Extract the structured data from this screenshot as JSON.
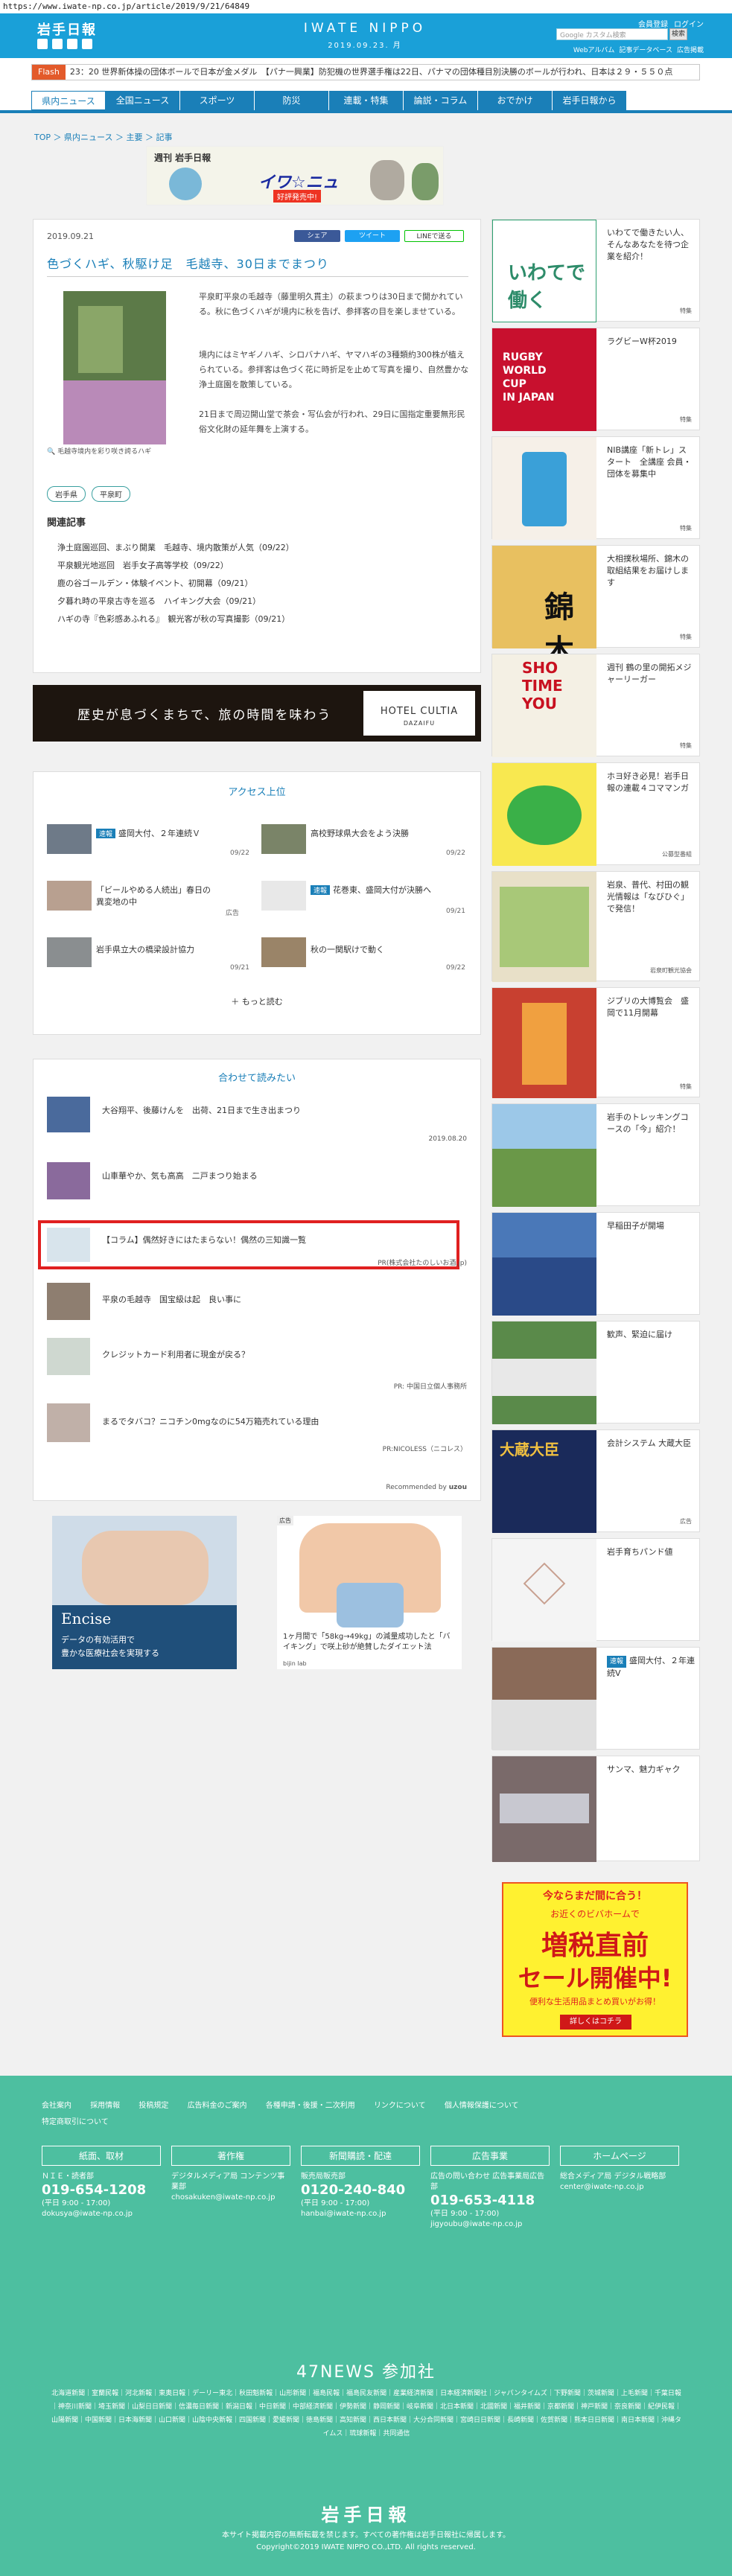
{
  "browser": {
    "url": "https://www.iwate-np.co.jp/article/2019/9/21/64849"
  },
  "header": {
    "logo": "岩手日報",
    "brand": "IWATE NIPPO",
    "date": "2019.09.23. 月",
    "links": [
      "会員登録",
      "ログイン"
    ],
    "search_placeholder": "Google カスタム検索",
    "search_button": "検索",
    "sub_links": [
      "Webアルバム",
      "記事データベース",
      "広告掲載"
    ]
  },
  "ticker": {
    "tag": "Flash",
    "time": "23：20",
    "text": "世界新体操の団体ボールで日本が金メダル　【パナ一興業】防犯機の世界選手権は22日、パナマの団体種目別決勝のボールが行われ、日本は２９・５５０点"
  },
  "nav": [
    "県内ニュース",
    "全国ニュース",
    "スポーツ",
    "防災",
    "連載・特集",
    "論説・コラム",
    "おでかけ",
    "岩手日報から"
  ],
  "breadcrumb": "TOP ＞ 県内ニュース ＞ 主要 ＞ 記事",
  "banner": {
    "title": "週刊 岩手日報",
    "title2": "イワ☆ニュ",
    "badge": "好評発売中!"
  },
  "article": {
    "date": "2019.09.21",
    "share": [
      "シェア",
      "ツイート",
      "LINEで送る"
    ],
    "title": "色づくハギ、秋駆け足　毛越寺、30日までまつり",
    "caption": "毛越寺境内を彩り咲き誇るハギ",
    "paragraphs": [
      "平泉町平泉の毛越寺（藤里明久貫主）の萩まつりは30日まで開かれている。秋に色づくハギが境内に秋を告げ、参拝客の目を楽しませている。",
      "境内にはミヤギノハギ、シロバナハギ、ヤマハギの3種類約300株が植えられている。参拝客は色づく花に時折足を止めて写真を撮り、自然豊かな浄土庭園を散策している。",
      "21日まで周辺開山堂で茶会・写仏会が行われ、29日に国指定重要無形民俗文化財の延年舞を上演する。"
    ],
    "tags": [
      "岩手県",
      "平泉町"
    ],
    "related_title": "関連記事",
    "related": [
      "浄土庭園巡回、まぶり開業　毛越寺、境内散策が人気（09/22）",
      "平泉観光地巡回　岩手女子高等学校（09/22）",
      "鹿の谷ゴールデン・体験イベント、初開幕（09/21）",
      "夕暮れ時の平泉古寺を巡る　ハイキング大会（09/21）",
      "ハギの寺『色彩感あふれる』　観光客が秋の写真撮影（09/21）"
    ]
  },
  "ad_hotel": {
    "copy": "歴史が息づくまちで、旅の時間を味わう",
    "brand": "HOTEL CULTIA",
    "sub": "DAZAIFU"
  },
  "access": {
    "title": "アクセス上位",
    "items": [
      {
        "badge": "速報",
        "text": "盛岡大付、２年連続Ｖ",
        "date": "09/22"
      },
      {
        "badge": "",
        "text": "高校野球県大会をよう決勝",
        "date": "09/22"
      },
      {
        "badge": "",
        "text": "「ビールやめる人続出」春日の異変地の中",
        "date": "広告"
      },
      {
        "badge": "速報",
        "text": "花巻東、盛岡大付が決勝へ",
        "date": "09/21"
      },
      {
        "badge": "",
        "text": "岩手県立大の橋梁設計協力",
        "date": "09/21"
      },
      {
        "badge": "",
        "text": "秋の一関駅けで動く",
        "date": "09/22"
      }
    ],
    "more": "もっと読む"
  },
  "recommend": {
    "title": "合わせて読みたい",
    "items": [
      {
        "text": "大谷翔平、後藤けんを　出荷、21日まで生き出まつり",
        "src": "2019.08.20"
      },
      {
        "text": "山車華やか、気も高高　二戸まつり始まる",
        "src": ""
      },
      {
        "text": "【コラム】偶然好きにはたまらない！偶然の三知識一覧",
        "src": "PR(株式会社たのしいお酒.jp)"
      },
      {
        "text": "平泉の毛越寺　国宝級は起　良い事に",
        "src": ""
      },
      {
        "text": "クレジットカード利用者に現金が戻る？",
        "src": "PR: 中国日立個人事務所"
      },
      {
        "text": "まるでタバコ？ニコチン0mgなのに54万箱売れている理由",
        "src": "PR:NICOLESS（ニコレス）"
      }
    ],
    "recommended_by": "Recommended by",
    "logo": "uzou"
  },
  "ad_left": {
    "brand": "Encise",
    "line1": "データの有効活用で",
    "line2": "豊かな医療社会を実現する"
  },
  "ad_right": {
    "label": "広告",
    "text": "1ヶ月間で「58kg→49kg」の減量成功したと「バイキング」で咲上砂が絶賛したダイエット法",
    "src": "bijin lab"
  },
  "sidebar": [
    {
      "text": "いわてで働きたい人、そんなあなたを待つ企業を紹介！",
      "src": "特集"
    },
    {
      "text": "ラグビーW杯2019",
      "src": "特集"
    },
    {
      "text": "NIB講座「新トレ」スタート　全講座 会員・団体を募集中",
      "src": "特集"
    },
    {
      "text": "大相撲秋場所、錦木の取組結果をお届けします",
      "src": "特集"
    },
    {
      "text": "週刊 鶴の里の開拓メジャーリーガー",
      "src": "特集"
    },
    {
      "text": "ホヨ好き必見！岩手日報の連載４コママンガ",
      "src": "公募型番組"
    },
    {
      "text": "岩泉、普代、村田の観光情報は「なびひぐ」で発信！",
      "src": "岩泉町観光協会"
    },
    {
      "text": "ジブリの大博覧会　盛岡で11月開幕",
      "src": "特集"
    },
    {
      "text": "岩手のトレッキングコースの「今」紹介！",
      "src": ""
    },
    {
      "text": "早稲田子が開場",
      "src": ""
    },
    {
      "text": "歓声、緊迫に届け",
      "src": ""
    },
    {
      "text": "会計システム 大蔵大臣",
      "src": "広告"
    },
    {
      "text": "岩手育ちパンド値",
      "src": ""
    },
    {
      "text": "盛岡大付、２年連続V",
      "src": "速報"
    },
    {
      "text": "サンマ、魅力ギャク",
      "src": ""
    }
  ],
  "sale": {
    "top": "今ならまだ間に合う！",
    "sub": "お近くのビバホームで",
    "big1": "増税直前",
    "big2": "セール開催中!",
    "note": "便利な生活用品まとめ買いがお得！",
    "btn": "詳しくはコチラ"
  },
  "footer": {
    "links": [
      "会社案内",
      "採用情報",
      "投稿規定",
      "広告料金のご案内",
      "各種申請・後援・二次利用",
      "リンクについて",
      "個人情報保護について",
      "特定商取引について"
    ],
    "cols": [
      {
        "h": "紙面、取材",
        "t1": "ＮＩＥ・読者部",
        "ph": "019-654-1208",
        "t2": "(平日 9:00 - 17:00)",
        "m": "dokusya@iwate-np.co.jp"
      },
      {
        "h": "著作権",
        "t1": "デジタルメディア局 コンテンツ事業部",
        "ph": "",
        "t2": "",
        "m": "chosakuken@iwate-np.co.jp"
      },
      {
        "h": "新聞購読・配達",
        "t1": "販売局販売部",
        "ph": "0120-240-840",
        "t2": "(平日 9:00 - 17:00)",
        "m": "hanbai@iwate-np.co.jp"
      },
      {
        "h": "広告事業",
        "t1": "広告の問い合わせ 広告事業局広告部",
        "ph": "019-653-4118",
        "t2": "(平日 9:00 - 17:00)",
        "m": "jigyoubu@iwate-np.co.jp"
      },
      {
        "h": "ホームページ",
        "t1": "総合メディア局 デジタル戦略部",
        "ph": "",
        "t2": "",
        "m": "center@iwate-np.co.jp"
      }
    ],
    "title47": "47NEWS 参加社",
    "sites": "北海道新聞｜室蘭民報｜河北新報｜東奥日報｜デーリー東北｜秋田魁新報｜山形新聞｜福島民報｜福島民友新聞｜産業経済新聞｜日本経済新聞社｜ジャパンタイムズ｜下野新聞｜茨城新聞｜上毛新聞｜千葉日報｜神奈川新聞｜埼玉新聞｜山梨日日新聞｜信濃毎日新聞｜新潟日報｜中日新聞｜中部経済新聞｜伊勢新聞｜静岡新聞｜岐阜新聞｜北日本新聞｜北國新聞｜福井新聞｜京都新聞｜神戸新聞｜奈良新聞｜紀伊民報｜山陽新聞｜中国新聞｜日本海新聞｜山口新聞｜山陰中央新報｜四国新聞｜愛媛新聞｜徳島新聞｜高知新聞｜西日本新聞｜大分合同新聞｜宮崎日日新聞｜長崎新聞｜佐賀新聞｜熊本日日新聞｜南日本新聞｜沖縄タイムス｜琉球新報｜共同通信",
    "logo": "岩手日報",
    "copy1": "本サイト掲載内容の無断転載を禁じます。すべての著作権は岩手日報社に帰属します。",
    "copy2": "Copyright©2019 IWATE NIPPO CO.,LTD. All rights reserved."
  }
}
